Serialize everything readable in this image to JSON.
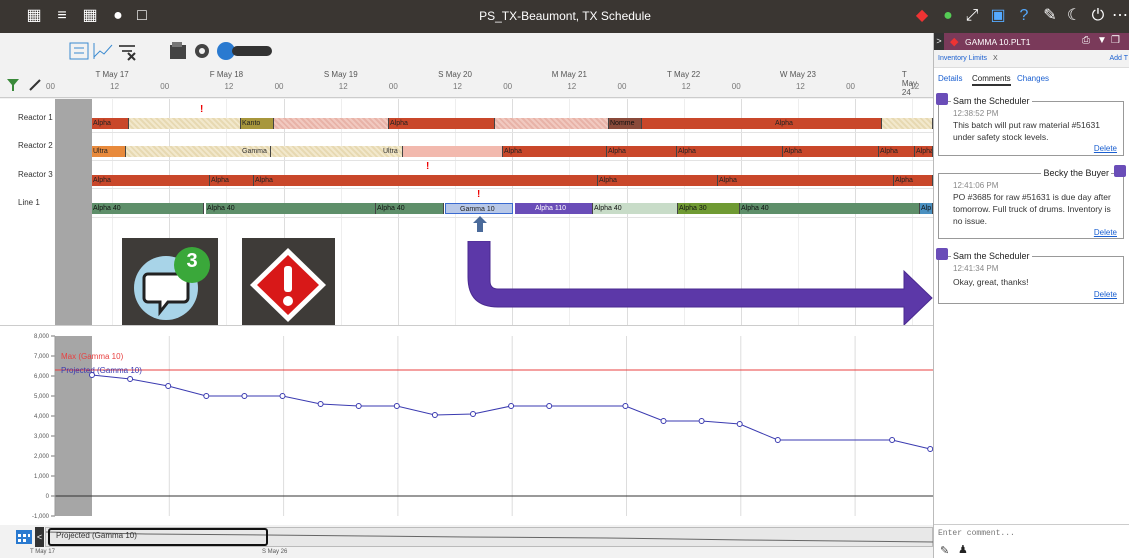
{
  "window": {
    "title": "PS_TX-Beaumont, TX Schedule"
  },
  "toolbar": {
    "left_icons": [
      "calendar-icon",
      "indent-icon",
      "grid-icon",
      "binoculars-icon",
      "bookmark-icon"
    ],
    "right_icons": [
      "alert-icon",
      "bus-icon",
      "expand-icon",
      "calculator-icon",
      "help-icon",
      "wrench-icon",
      "moon-icon",
      "power-icon",
      "more-icon"
    ]
  },
  "timeline": {
    "days": [
      "T May 17",
      "F May 18",
      "S May 19",
      "S May 20",
      "M May 21",
      "T May 22",
      "W May 23",
      "T May 24"
    ],
    "hour_labels": [
      "00",
      "12"
    ]
  },
  "gantt": {
    "rows": [
      "Reactor 1",
      "Reactor 2",
      "Reactor 3",
      "Line 1"
    ],
    "bars": [
      {
        "row": 0,
        "label": "Alpha",
        "style": "red"
      },
      {
        "row": 0,
        "label": "Kanto",
        "style": "olive"
      },
      {
        "row": 0,
        "label": "Alpha",
        "style": "pink"
      },
      {
        "row": 0,
        "label": "Nomme",
        "style": "brn"
      },
      {
        "row": 0,
        "label": "Alpha",
        "style": "red"
      },
      {
        "row": 1,
        "label": "Ultra",
        "style": "orange"
      },
      {
        "row": 1,
        "label": "Gamma",
        "style": "tan"
      },
      {
        "row": 1,
        "label": "Ultra",
        "style": "tan"
      },
      {
        "row": 1,
        "label": "Alpha",
        "style": "red"
      },
      {
        "row": 1,
        "label": "Alpha",
        "style": "red"
      },
      {
        "row": 1,
        "label": "Alpha",
        "style": "red"
      },
      {
        "row": 1,
        "label": "Alpha",
        "style": "red"
      },
      {
        "row": 1,
        "label": "Alpha",
        "style": "red"
      },
      {
        "row": 1,
        "label": "Alpha",
        "style": "red"
      },
      {
        "row": 2,
        "label": "Alpha",
        "style": "red"
      },
      {
        "row": 2,
        "label": "Alpha",
        "style": "red"
      },
      {
        "row": 2,
        "label": "Alpha",
        "style": "red"
      },
      {
        "row": 2,
        "label": "Alpha",
        "style": "red"
      },
      {
        "row": 2,
        "label": "Alpha",
        "style": "red"
      },
      {
        "row": 2,
        "label": "Alpha",
        "style": "red"
      },
      {
        "row": 3,
        "label": "Alpha 40",
        "style": "green"
      },
      {
        "row": 3,
        "label": "Alpha 40",
        "style": "green"
      },
      {
        "row": 3,
        "label": "Alpha 40",
        "style": "green"
      },
      {
        "row": 3,
        "label": "Gamma 10",
        "style": "ltblue"
      },
      {
        "row": 3,
        "label": "Alpha 110",
        "style": "purple"
      },
      {
        "row": 3,
        "label": "Alpha 40",
        "style": "ltgreen"
      },
      {
        "row": 3,
        "label": "Alpha 30",
        "style": "grn2"
      },
      {
        "row": 3,
        "label": "Alpha 40",
        "style": "green"
      },
      {
        "row": 3,
        "label": "Alp",
        "style": "blue"
      }
    ],
    "comment_badge_count": "3"
  },
  "chart_data": {
    "type": "line",
    "ylim": [
      -1000,
      8000
    ],
    "yticks": [
      -1000,
      0,
      1000,
      2000,
      3000,
      4000,
      5000,
      6000,
      7000,
      8000
    ],
    "ytick_labels": [
      "-1,000",
      "0",
      "1,000",
      "2,000",
      "3,000",
      "4,000",
      "5,000",
      "6,000",
      "7,000",
      "8,000"
    ],
    "series": [
      {
        "name": "Max (Gamma 10)",
        "color": "#e84040",
        "values": [
          6300,
          6300
        ]
      },
      {
        "name": "Projected (Gamma 10)",
        "color": "#3a3ab0",
        "points": [
          [
            0,
            6050
          ],
          [
            0.5,
            5850
          ],
          [
            1,
            5500
          ],
          [
            1.5,
            5000
          ],
          [
            2,
            5000
          ],
          [
            2.5,
            5000
          ],
          [
            3,
            4600
          ],
          [
            3.5,
            4500
          ],
          [
            4,
            4500
          ],
          [
            4.5,
            4050
          ],
          [
            5,
            4100
          ],
          [
            5.5,
            4500
          ],
          [
            6,
            4500
          ],
          [
            7,
            4500
          ],
          [
            7.5,
            3750
          ],
          [
            8,
            3750
          ],
          [
            8.5,
            3600
          ],
          [
            9,
            2800
          ],
          [
            10.5,
            2800
          ],
          [
            11,
            2350
          ]
        ]
      }
    ]
  },
  "scroller": {
    "label": "Projected (Gamma 10)",
    "start": "T May 17",
    "mid": "S May 26"
  },
  "side_panel": {
    "title": "GAMMA 10.PLT1",
    "tab_label": "Inventory Limits",
    "tab_close": "X",
    "add_label": "Add T",
    "subtabs": [
      "Details",
      "Comments",
      "Changes"
    ],
    "comments": [
      {
        "author": "Sam the Scheduler",
        "time": "12:38:52 PM",
        "text": "This batch will put raw material #51631 under safety stock levels.",
        "delete": "Delete",
        "align": "left"
      },
      {
        "author": "Becky the Buyer",
        "time": "12:41:06 PM",
        "text": "PO #3685 for raw #51631 is due day after tomorrow. Full truck of drums. Inventory is no issue.",
        "delete": "Delete",
        "align": "right"
      },
      {
        "author": "Sam the Scheduler",
        "time": "12:41:34 PM",
        "text": "Okay, great, thanks!",
        "delete": "Delete",
        "align": "left"
      }
    ],
    "comment_placeholder": "Enter comment..."
  }
}
